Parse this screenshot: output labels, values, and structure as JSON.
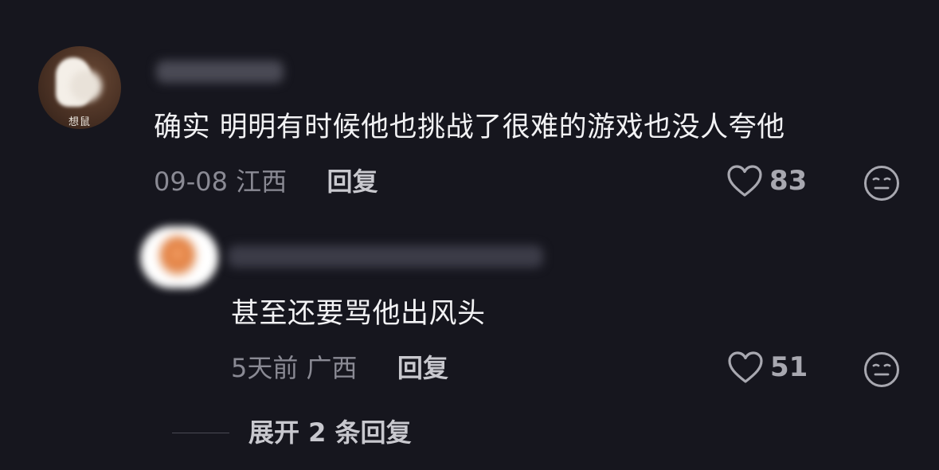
{
  "comment": {
    "avatar_caption": "想鼠",
    "text": "确实  明明有时候他也挑战了很难的游戏也没人夸他",
    "date": "09-08",
    "location": "江西",
    "reply_label": "回复",
    "like_count": "83",
    "like_icon": "heart-outline-icon",
    "reaction_icon": "expressionless-face-icon"
  },
  "reply": {
    "text": "甚至还要骂他出风头",
    "date": "5天前",
    "location": "广西",
    "reply_label": "回复",
    "like_count": "51",
    "like_icon": "heart-outline-icon",
    "reaction_icon": "expressionless-face-icon"
  },
  "expand": {
    "label": "展开 2 条回复"
  },
  "colors": {
    "background": "#16161e",
    "primary_text": "#f2f2f4",
    "secondary_text": "#8a8a94",
    "action_text": "#c8c8ce"
  }
}
